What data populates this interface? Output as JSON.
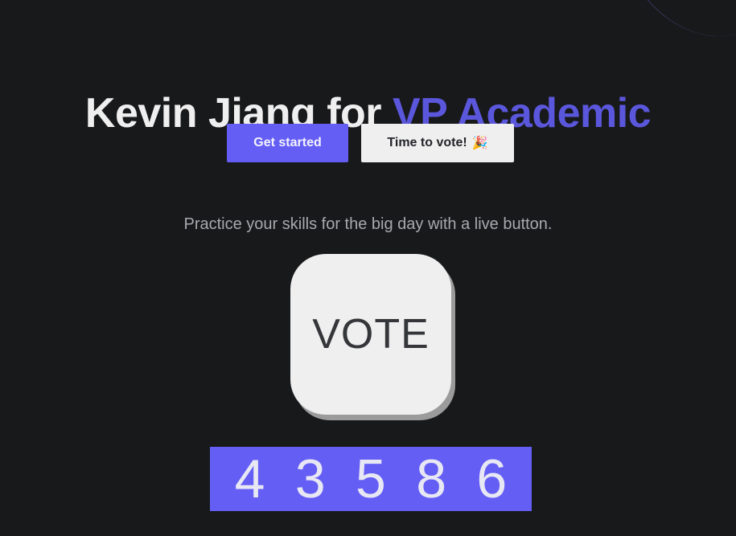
{
  "hero": {
    "title_prefix": "Kevin Jiang for ",
    "title_accent": "VP Academic"
  },
  "actions": {
    "primary_label": "Get started",
    "secondary_label": "Time to vote!",
    "secondary_emoji": "🎉"
  },
  "practice": {
    "subtitle": "Practice your skills for the big day with a live button.",
    "vote_label": "VOTE"
  },
  "counter": {
    "digits": [
      "4",
      "3",
      "5",
      "8",
      "6"
    ]
  },
  "colors": {
    "background": "#18191b",
    "accent": "#5b57dc",
    "primary": "#645ef5",
    "light": "#efefef"
  }
}
